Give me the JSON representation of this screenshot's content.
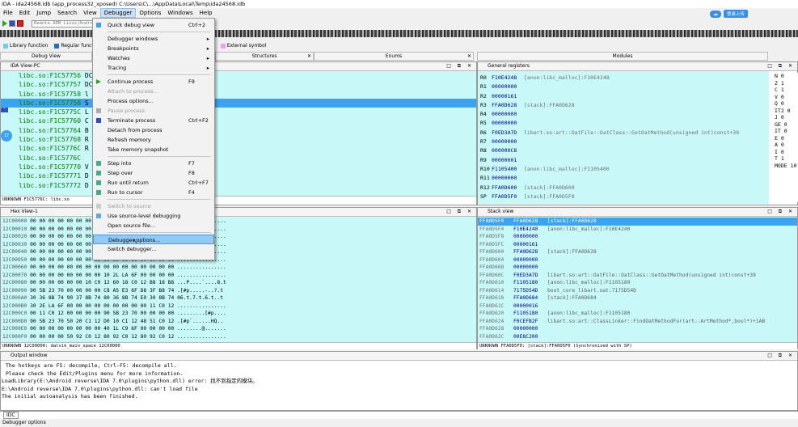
{
  "titlebar": {
    "title": "IDA - ida24568.idb (app_process32_xposed) C:\\Users\\C\\...\\AppData\\Local\\Temp\\ida24568.idb"
  },
  "sync": {
    "button": "登录上传"
  },
  "menubar": {
    "items": [
      "File",
      "Edit",
      "Jump",
      "Search",
      "View",
      "Debugger",
      "Options",
      "Windows",
      "Help"
    ]
  },
  "toolbar": {
    "remote_label": "Remote ARM Linux/Android debugger"
  },
  "legend": {
    "items": [
      {
        "label": "Library function",
        "color": "#78c8f0"
      },
      {
        "label": "Regular function",
        "color": "#2470c0"
      },
      {
        "label": "Instruction",
        "color": "#c08060"
      },
      {
        "label": "External symbol",
        "color": "#f0a0f0"
      }
    ]
  },
  "tabs": [
    {
      "label": "Debug View"
    },
    {
      "label": "Structures"
    },
    {
      "label": "Enums"
    },
    {
      "label": "Modules"
    }
  ],
  "ida_view": {
    "title": "IDA View-PC",
    "lines": [
      {
        "addr": "libc.so:F1C57756",
        "rest": "DCB 0"
      },
      {
        "addr": "libc.so:F1C57757",
        "rest": "DCB"
      },
      {
        "addr": "libc.so:F1C57758",
        "rest": "l"
      },
      {
        "addr": "libc.so:F1C57758",
        "rest": "S"
      },
      {
        "addr": "libc.so:F1C5775C",
        "rest": "L"
      },
      {
        "addr": "libc.so:F1C57760",
        "rest": "C"
      },
      {
        "addr": "libc.so:F1C57764",
        "rest": "B"
      },
      {
        "addr": "libc.so:F1C57768",
        "rest": "R"
      },
      {
        "addr": "libc.so:F1C5776C",
        "rest": "R"
      },
      {
        "addr": "libc.so:F1C5776C",
        "rest": ""
      },
      {
        "addr": "libc.so:F1C57770",
        "rest": "V"
      },
      {
        "addr": "libc.so:F1C57771",
        "rest": "D"
      },
      {
        "addr": "libc.so:F1C57772",
        "rest": "D"
      }
    ],
    "status": "UNKNOWN F1C5776C: libc.so"
  },
  "registers": {
    "title": "General registers",
    "rows": [
      {
        "name": "R0",
        "value": "F10E4248",
        "comment": "[anon:libc_malloc]:F10E4248"
      },
      {
        "name": "R1",
        "value": "00000000",
        "comment": ""
      },
      {
        "name": "R2",
        "value": "00000161",
        "comment": ""
      },
      {
        "name": "R3",
        "value": "FFA0D628",
        "comment": "[stack]:FFA0D628"
      },
      {
        "name": "R4",
        "value": "00000000",
        "comment": ""
      },
      {
        "name": "R5",
        "value": "00000000",
        "comment": ""
      },
      {
        "name": "R6",
        "value": "F0ED3A7D",
        "comment": "libart.so:art::OatFile::OatClass::GetOatMethod(unsigned int)const+39"
      },
      {
        "name": "R7",
        "value": "00000000",
        "comment": ""
      },
      {
        "name": "R8",
        "value": "000000C8",
        "comment": ""
      },
      {
        "name": "R9",
        "value": "00000001",
        "comment": ""
      },
      {
        "name": "R10",
        "value": "F1105400",
        "comment": "[anon:libc_malloc]:F1105400"
      },
      {
        "name": "R11",
        "value": "00000000",
        "comment": ""
      },
      {
        "name": "R12",
        "value": "FFA0D600",
        "comment": "[stack]:FFA0D600"
      },
      {
        "name": "SP",
        "value": "FFA0D5F0",
        "comment": "[stack]:FFA0D5F0"
      }
    ],
    "flags": [
      "N 0",
      "Z 1",
      "C 1",
      "V 0",
      "Q 0",
      "IT2 0",
      "J 0",
      "GE 0",
      "IT 0",
      "E 0",
      "A 0",
      "I 0",
      "T 1",
      "MODE 10"
    ]
  },
  "hex_view": {
    "title": "Hex View-1",
    "rows": [
      {
        "addr": "12C00000",
        "bytes": "00 00 00 00 00 00 00 00 00 00 00 00 00 00 00 00",
        "ascii": "................"
      },
      {
        "addr": "12C00010",
        "bytes": "00 00 00 00 00 00 00 00 00 00 00 00 00 00 00 00",
        "ascii": "................"
      },
      {
        "addr": "12C00020",
        "bytes": "00 00 00 00 00 00 00 00 00 00 00 00 00 00 00 00",
        "ascii": "................"
      },
      {
        "addr": "12C00030",
        "bytes": "00 00 00 00 00 00 00 00 00 00 00 00 00 00 00 00",
        "ascii": "................"
      },
      {
        "addr": "12C00040",
        "bytes": "00 00 00 00 00 00 00 00 00 00 00 00 00 00 00 00",
        "ascii": "................"
      },
      {
        "addr": "12C00050",
        "bytes": "00 00 00 00 00 00 00 00 00 00 00 00 00 00 00 00",
        "ascii": "................"
      },
      {
        "addr": "12C00060",
        "bytes": "00 00 00 00 00 00 00 00 00 00 00 00 00 00 00 00",
        "ascii": "................"
      },
      {
        "addr": "12C00070",
        "bytes": "00 00 00 00 00 00 00 00 10 2L LA 6F 00 00 00 00",
        "ascii": "................"
      },
      {
        "addr": "12C00080",
        "bytes": "00 00 00 00 00 00 10 C0 12 60 18 C0 12 B8 18 B8",
        "ascii": "...P....`....8.t"
      },
      {
        "addr": "12C00090",
        "bytes": "90 5B 23 70 00 00 00 00 C8 A5 E3 6F D8 3F B8 74",
        "ascii": ".[#p.....-..?.t"
      },
      {
        "addr": "12C000A0",
        "bytes": "30 36 8B 74 90 37 8B 74 80 36 8B 74 E0 30 8B 74",
        "ascii": "06.t.7.t.6.t..t"
      },
      {
        "addr": "12C000B0",
        "bytes": "30 2E LA 6F 00 00 00 00 00 00 00 00 00 11 C0 12",
        "ascii": "................"
      },
      {
        "addr": "12C000C0",
        "bytes": "00 11 C0 12 00 00 00 00 90 5B 23 70 00 00 00 00",
        "ascii": ".........[#p...."
      },
      {
        "addr": "12C000D0",
        "bytes": "90 5B 23 70 50 20 C1 12 D0 10 C1 12 48 51 C0 12",
        "ascii": ".[#p`......HQ.."
      },
      {
        "addr": "12C000E0",
        "bytes": "00 00 00 00 00 00 00 00 40 1L C9 6F 00 00 00 00",
        "ascii": "........@......."
      },
      {
        "addr": "12C000F0",
        "bytes": "00 00 00 00 50 92 C0 12 80 92 C0 12 80 92 C0 12",
        "ascii": "................"
      }
    ],
    "status": "UNKNOWN 12C00000: dalvik_main_space 12C00000"
  },
  "stack_view": {
    "title": "Stack view",
    "rows": [
      {
        "addr": "FFA0D5F0",
        "value": "FFA0D628",
        "comment": "[stack]:FFA0D628"
      },
      {
        "addr": "FFA0D5F4",
        "value": "F10E4240",
        "comment": "[anon:libc_malloc]:F10E4240"
      },
      {
        "addr": "FFA0D5F8",
        "value": "00000000",
        "comment": ""
      },
      {
        "addr": "FFA0D5FC",
        "value": "00000161",
        "comment": ""
      },
      {
        "addr": "FFA0D600",
        "value": "FFA0D628",
        "comment": "[stack]:FFA0D628"
      },
      {
        "addr": "FFA0D604",
        "value": "00000000",
        "comment": ""
      },
      {
        "addr": "FFA0D608",
        "value": "00000000",
        "comment": ""
      },
      {
        "addr": "FFA0D60C",
        "value": "F0ED3A7D",
        "comment": "libart.so:art::OatFile::OatClass::GetOatMethod(unsigned int)const+39"
      },
      {
        "addr": "FFA0D610",
        "value": "F1105180",
        "comment": "[anon:libc_malloc]:F1105180"
      },
      {
        "addr": "FFA0D614",
        "value": "7175D54D",
        "comment": "boot_core_libart.oat:7175D54D"
      },
      {
        "addr": "FFA0D618",
        "value": "FFA0D684",
        "comment": "[stack]:FFA0D684"
      },
      {
        "addr": "FFA0D61C",
        "value": "00000016",
        "comment": ""
      },
      {
        "addr": "FFA0D620",
        "value": "F1105180",
        "comment": "[anon:libc_malloc]:F1105180"
      },
      {
        "addr": "FFA0D624",
        "value": "F0CEFB2F",
        "comment": "libart.so:art::ClassLinker::FindOatMethodFor(art::ArtMethod*,bool*)+1AB"
      },
      {
        "addr": "FFA0D628",
        "value": "00000000",
        "comment": ""
      },
      {
        "addr": "FFA0D62C",
        "value": "00E8C200",
        "comment": ""
      }
    ],
    "status": "UNKNOWN FFA0D5F0: [stack]:FFA0D5F0 (Synchronized with SP)"
  },
  "output": {
    "title": "Output window",
    "lines": [
      "  The hotkeys are F5: decompile, Ctrl-F5: decompile all.",
      "  Please check the Edit/Plugins menu for more information.",
      "",
      "LoadLibrary(E:\\Android reverse\\IDA 7.0\\plugins\\python.dll) error: 找不到指定的模块。",
      "E:\\Android reverse\\IDA 7.0\\plugins\\python.dll: can't load file",
      "The initial autoanalysis has been finished."
    ],
    "idc_label": "IDC"
  },
  "statusbar": {
    "text": "Debugger options"
  },
  "debugger_menu": {
    "groups": [
      [
        {
          "label": "Quick debug view",
          "shortcut": "Ctrl+2",
          "disabled": false,
          "submenu": false,
          "icon": "quick-view-icon"
        }
      ],
      [
        {
          "label": "Debugger windows",
          "shortcut": "",
          "disabled": false,
          "submenu": true
        },
        {
          "label": "Breakpoints",
          "shortcut": "",
          "disabled": false,
          "submenu": true
        },
        {
          "label": "Watches",
          "shortcut": "",
          "disabled": false,
          "submenu": true
        },
        {
          "label": "Tracing",
          "shortcut": "",
          "disabled": false,
          "submenu": true
        }
      ],
      [
        {
          "label": "Continue process",
          "shortcut": "F9",
          "disabled": false,
          "submenu": false,
          "icon": "play-icon"
        },
        {
          "label": "Attach to process...",
          "shortcut": "",
          "disabled": true,
          "submenu": false
        },
        {
          "label": "Process options...",
          "shortcut": "",
          "disabled": false,
          "submenu": false
        },
        {
          "label": "Pause process",
          "shortcut": "",
          "disabled": true,
          "submenu": false,
          "icon": "pause-icon"
        },
        {
          "label": "Terminate process",
          "shortcut": "Ctrl+F2",
          "disabled": false,
          "submenu": false,
          "icon": "stop-icon"
        },
        {
          "label": "Detach from process",
          "shortcut": "",
          "disabled": false,
          "submenu": false
        },
        {
          "label": "Refresh memory",
          "shortcut": "",
          "disabled": false,
          "submenu": false
        },
        {
          "label": "Take memory snapshot",
          "shortcut": "",
          "disabled": false,
          "submenu": false
        }
      ],
      [
        {
          "label": "Step into",
          "shortcut": "F7",
          "disabled": false,
          "submenu": false,
          "icon": "step-into-icon"
        },
        {
          "label": "Step over",
          "shortcut": "F8",
          "disabled": false,
          "submenu": false,
          "icon": "step-over-icon"
        },
        {
          "label": "Run until return",
          "shortcut": "Ctrl+F7",
          "disabled": false,
          "submenu": false,
          "icon": "run-return-icon"
        },
        {
          "label": "Run to cursor",
          "shortcut": "F4",
          "disabled": false,
          "submenu": false,
          "icon": "run-cursor-icon"
        }
      ],
      [
        {
          "label": "Switch to source",
          "shortcut": "",
          "disabled": true,
          "submenu": false,
          "icon": "source-icon"
        },
        {
          "label": "Use source-level debugging",
          "shortcut": "",
          "disabled": false,
          "submenu": false,
          "icon": "source-debug-icon"
        },
        {
          "label": "Open source file...",
          "shortcut": "",
          "disabled": false,
          "submenu": false
        }
      ],
      [
        {
          "label": "Debugger options...",
          "shortcut": "",
          "disabled": false,
          "submenu": false,
          "highlighted": true
        },
        {
          "label": "Switch debugger...",
          "shortcut": "",
          "disabled": false,
          "submenu": false
        }
      ]
    ]
  }
}
